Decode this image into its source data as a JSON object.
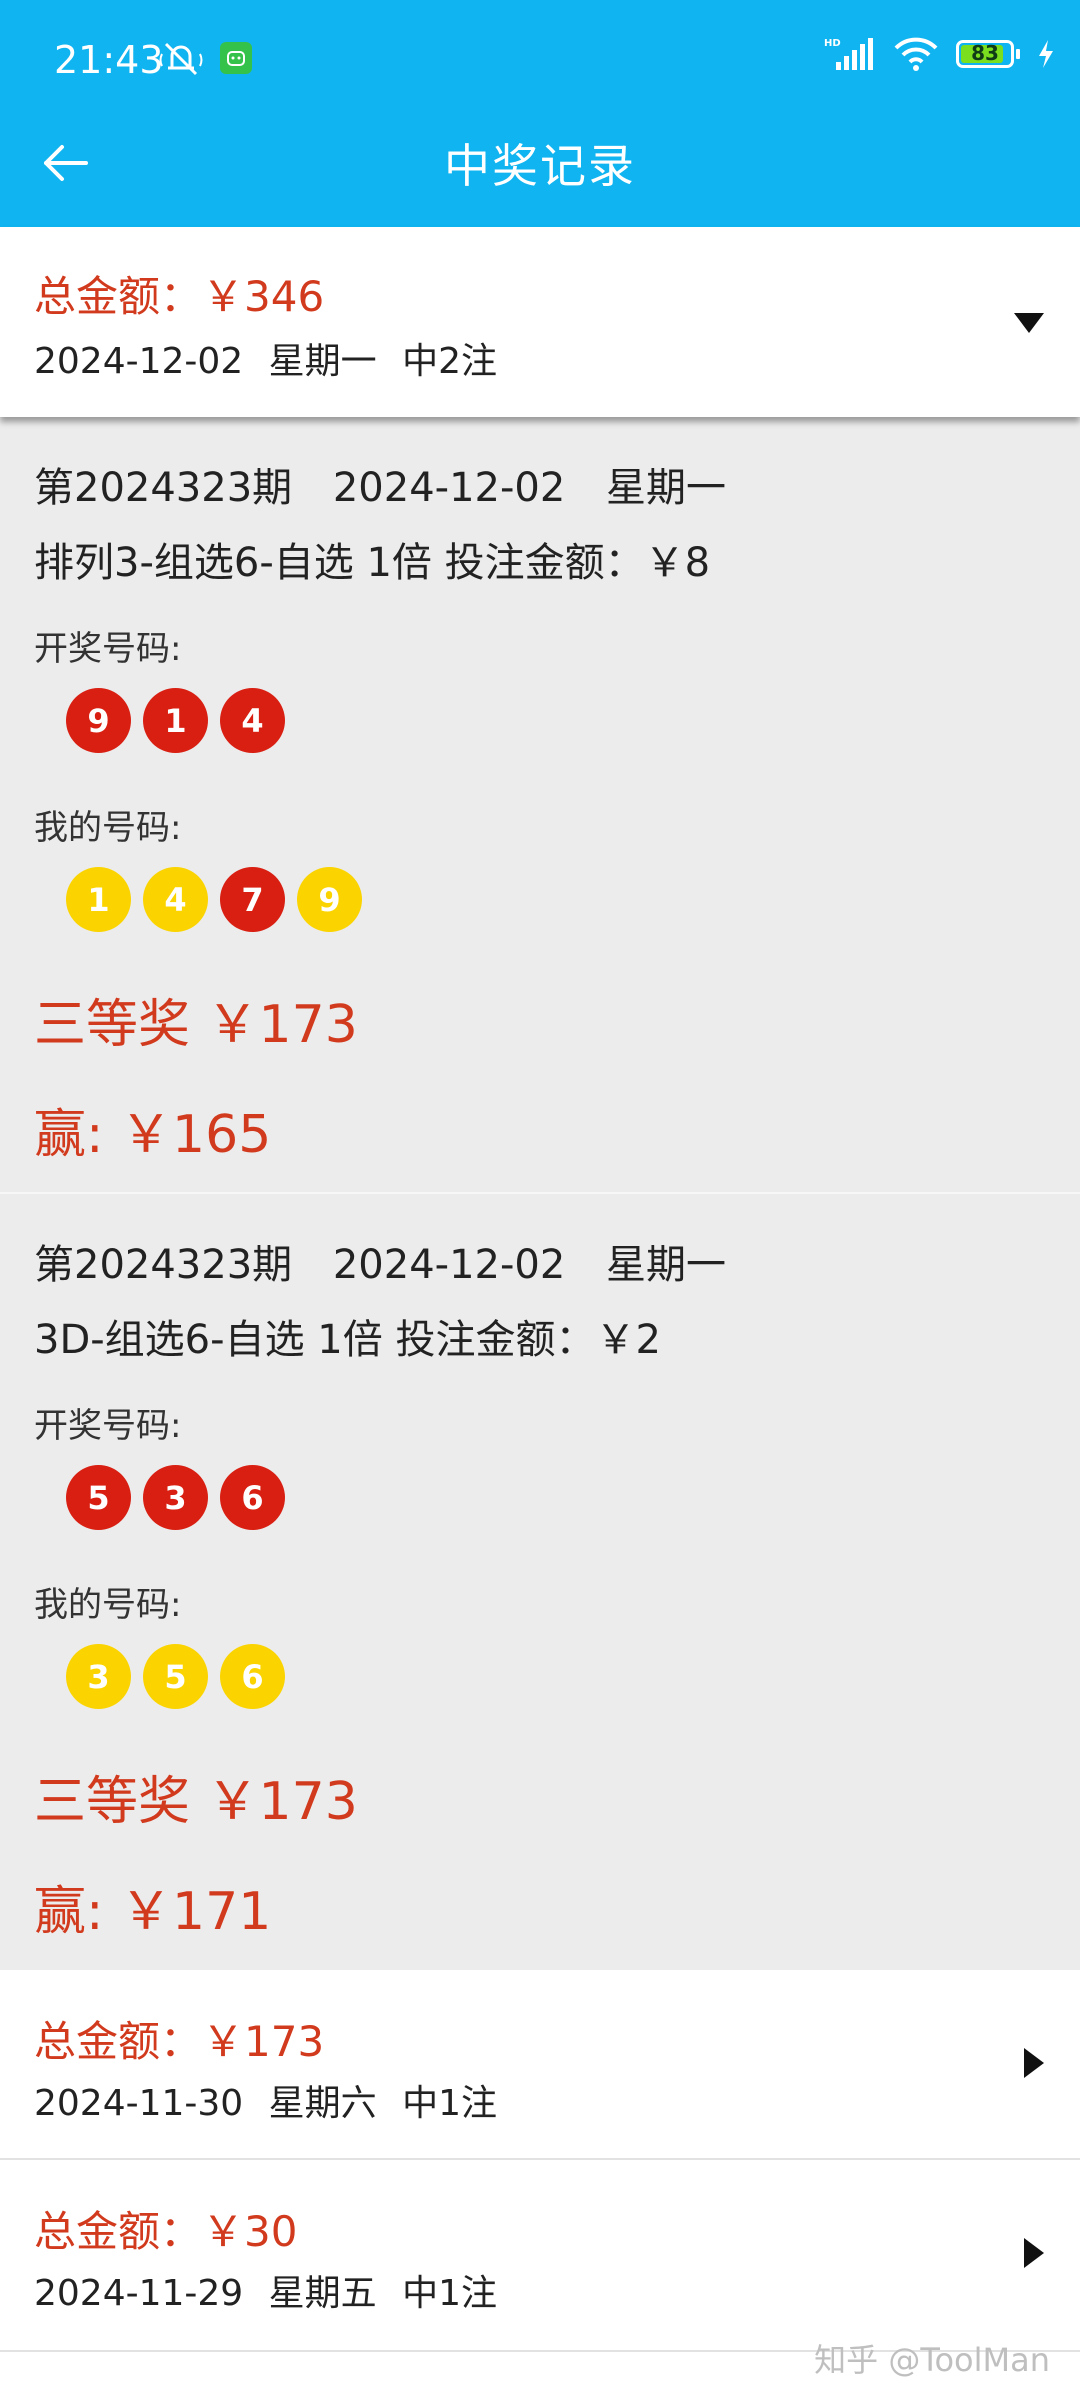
{
  "status_bar": {
    "time": "21:43",
    "battery": "83",
    "icons": [
      "mute-icon",
      "app-notification-icon",
      "hd-signal-icon",
      "wifi-icon",
      "battery-icon",
      "charging-icon"
    ]
  },
  "header": {
    "title": "中奖记录",
    "back_icon": "arrow-left-icon"
  },
  "colors": {
    "header_bg": "#0fb4f0",
    "accent_red": "#d23a1e",
    "ball_red": "#d91f12",
    "ball_yellow": "#fbd400",
    "card_bg": "#ececec"
  },
  "summary_expanded": {
    "total": "总金额：￥346",
    "info": "2024-12-02 星期一 中2注"
  },
  "details": [
    {
      "line1": "第2024323期 2024-12-02 星期一",
      "line2": "排列3-组选6-自选   1倍   投注金额：￥8",
      "draw_label": "开奖号码:",
      "draw_numbers": [
        "9",
        "1",
        "4"
      ],
      "my_label": "我的号码:",
      "my_numbers": [
        "1",
        "4",
        "7",
        "9"
      ],
      "my_number_colors": [
        "yellow",
        "yellow",
        "red",
        "yellow"
      ],
      "prize": "三等奖   ￥173",
      "win": "赢: ￥165"
    },
    {
      "line1": "第2024323期 2024-12-02 星期一",
      "line2": "3D-组选6-自选   1倍   投注金额：￥2",
      "draw_label": "开奖号码:",
      "draw_numbers": [
        "5",
        "3",
        "6"
      ],
      "my_label": "我的号码:",
      "my_numbers": [
        "3",
        "5",
        "6"
      ],
      "my_number_colors": [
        "yellow",
        "yellow",
        "yellow"
      ],
      "prize": "三等奖   ￥173",
      "win": "赢: ￥171"
    }
  ],
  "summary_rows": [
    {
      "total": "总金额：￥173",
      "info": "2024-11-30 星期六 中1注"
    },
    {
      "total": "总金额：￥30",
      "info": "2024-11-29 星期五 中1注"
    }
  ],
  "watermark": "知乎 @ToolMan"
}
